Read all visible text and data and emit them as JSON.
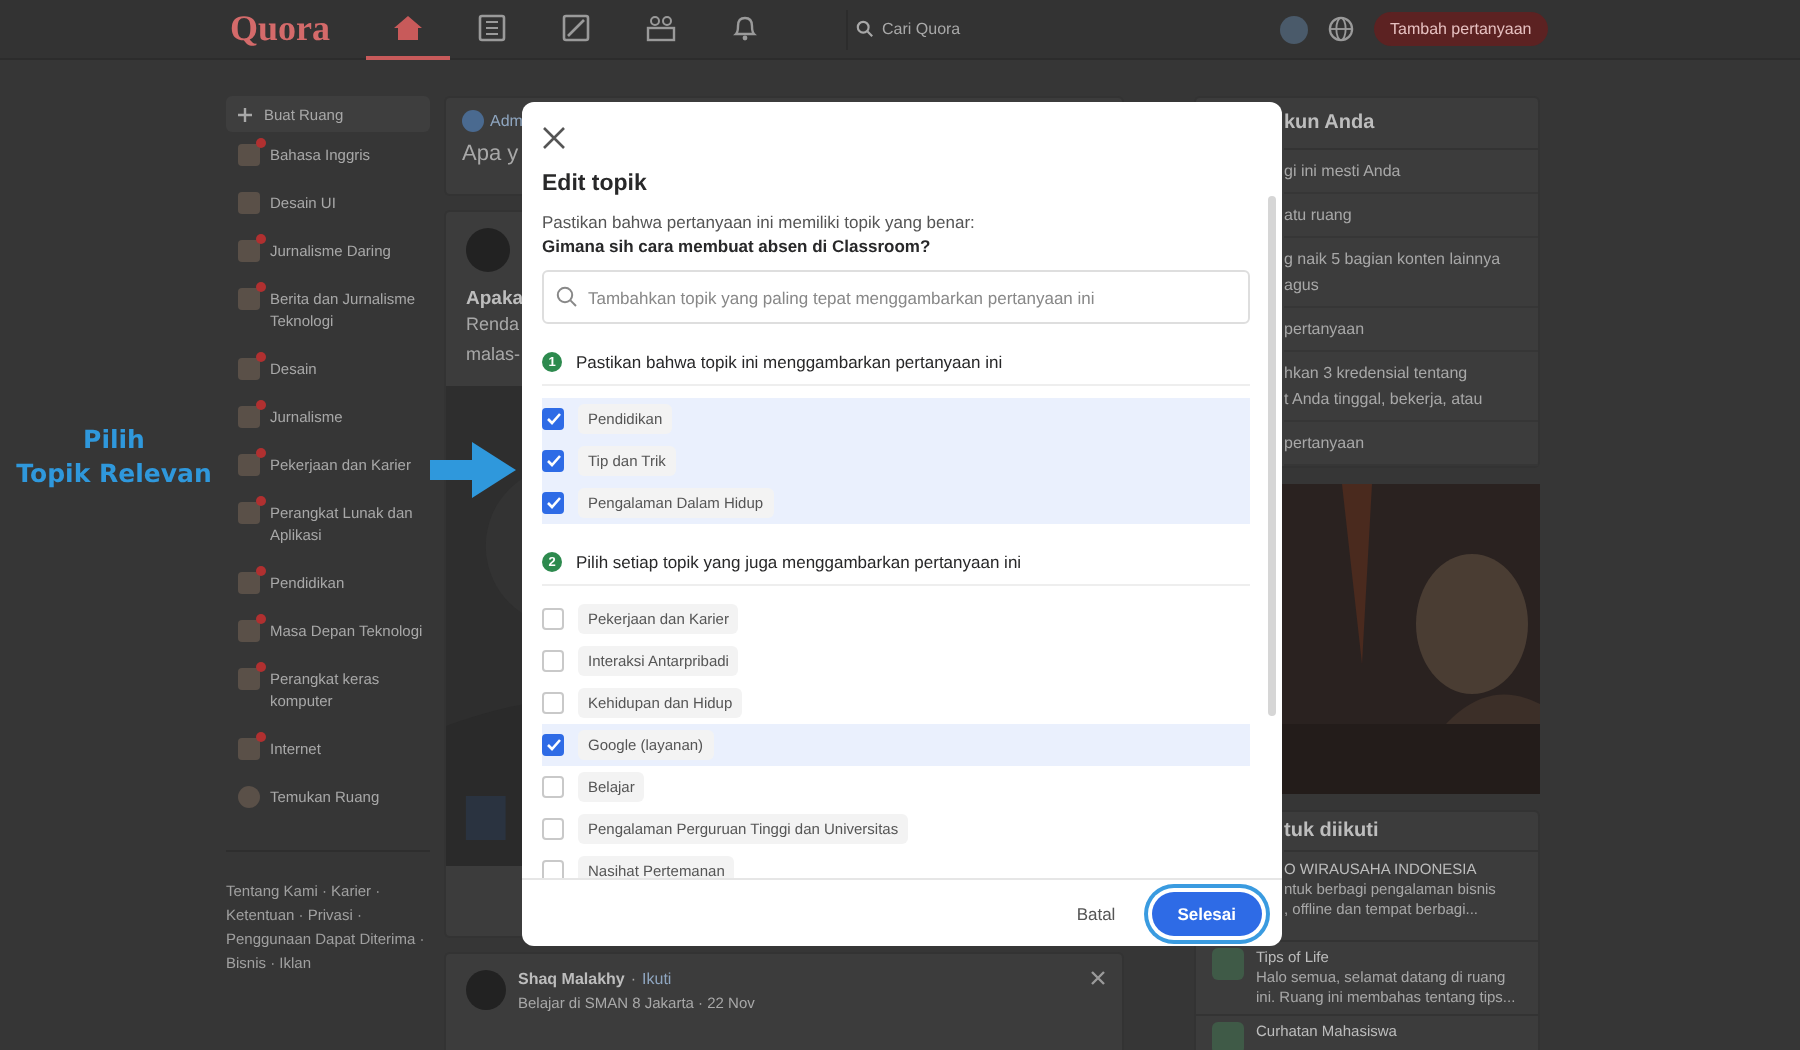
{
  "header": {
    "logo": "Quora",
    "nav": [
      {
        "selected": true
      },
      {
        "selected": false
      },
      {
        "selected": false
      },
      {
        "selected": false
      },
      {
        "selected": false
      }
    ],
    "search": {
      "placeholder": "Cari Quora"
    },
    "add_question_button": "Tambah pertanyaan"
  },
  "sidebar": {
    "create_space": "Buat Ruang",
    "spaces": [
      {
        "name": "Bahasa Inggris",
        "unread": true
      },
      {
        "name": "Desain UI",
        "unread": false
      },
      {
        "name": "Jurnalisme Daring",
        "unread": true
      },
      {
        "name": "Berita dan Jurnalisme Teknologi",
        "unread": true
      },
      {
        "name": "Desain",
        "unread": true
      },
      {
        "name": "Jurnalisme",
        "unread": true
      },
      {
        "name": "Pekerjaan dan Karier",
        "unread": true
      },
      {
        "name": "Perangkat Lunak dan Aplikasi",
        "unread": true
      },
      {
        "name": "Pendidikan",
        "unread": true
      },
      {
        "name": "Masa Depan Teknologi",
        "unread": true
      },
      {
        "name": "Perangkat keras komputer",
        "unread": true
      },
      {
        "name": "Internet",
        "unread": true
      }
    ],
    "discover": "Temukan Ruang",
    "footer": "Tentang Kami · Karier · Ketentuan · Privasi · Penggunaan Dapat Diterima · Bisnis · Iklan"
  },
  "feed": {
    "ask_box": {
      "user": "Adm",
      "prompt": "Apa y"
    },
    "post": {
      "title": "Apaka",
      "excerpt": "Renda\nmalas-",
      "media": {
        "kind": "picture"
      }
    },
    "next_post": {
      "author": "Shaq Malakhy",
      "separator": "·",
      "follow": "Ikuti",
      "meta": "Belajar di SMAN 8 Jakarta · 22 Nov"
    }
  },
  "right_panel": {
    "title": "kun Anda",
    "tasks": [
      "gi ini mesti Anda",
      "atu ruang",
      "g naik 5 bagian konten lainnya\nagus",
      "pertanyaan",
      "hkan 3 kredensial tentang\nt Anda tinggal, bekerja, atau",
      "pertanyaan"
    ],
    "ad": {
      "kind": "picture"
    },
    "spaces_title": "tuk diikuti",
    "covered_spaces": [
      {
        "name": "O WIRAUSAHA INDONESIA",
        "description": "ntuk berbagi pengalaman bisnis\n, offline dan tempat berbagi..."
      }
    ],
    "spaces": [
      {
        "name": "Tips of Life",
        "description": "Halo semua, selamat datang di ruang ini. Ruang ini membahas tentang tips..."
      },
      {
        "name": "Curhatan Mahasiswa"
      }
    ]
  },
  "annotation": {
    "text": "Pilih\nTopik Relevan"
  },
  "modal": {
    "title": "Edit topik",
    "intro": "Pastikan bahwa pertanyaan ini memiliki topik yang benar:",
    "question": "Gimana sih cara membuat absen di Classroom?",
    "search": {
      "placeholder": "Tambahkan topik yang paling tepat menggambarkan pertanyaan ini"
    },
    "sections": [
      {
        "number": "1",
        "heading": "Pastikan bahwa topik ini menggambarkan pertanyaan ini",
        "topics": [
          {
            "label": "Pendidikan",
            "checked": true
          },
          {
            "label": "Tip dan Trik",
            "checked": true
          },
          {
            "label": "Pengalaman Dalam Hidup",
            "checked": true
          }
        ]
      },
      {
        "number": "2",
        "heading": "Pilih setiap topik yang juga menggambarkan pertanyaan ini",
        "topics": [
          {
            "label": "Pekerjaan dan Karier",
            "checked": false
          },
          {
            "label": "Interaksi Antarpribadi",
            "checked": false
          },
          {
            "label": "Kehidupan dan Hidup",
            "checked": false
          },
          {
            "label": "Google (layanan)",
            "checked": true
          },
          {
            "label": "Belajar",
            "checked": false
          },
          {
            "label": "Pengalaman Perguruan Tinggi dan Universitas",
            "checked": false
          },
          {
            "label": "Nasihat Pertemanan",
            "checked": false
          }
        ]
      }
    ],
    "cancel_button": "Batal",
    "done_button": "Selesai"
  }
}
